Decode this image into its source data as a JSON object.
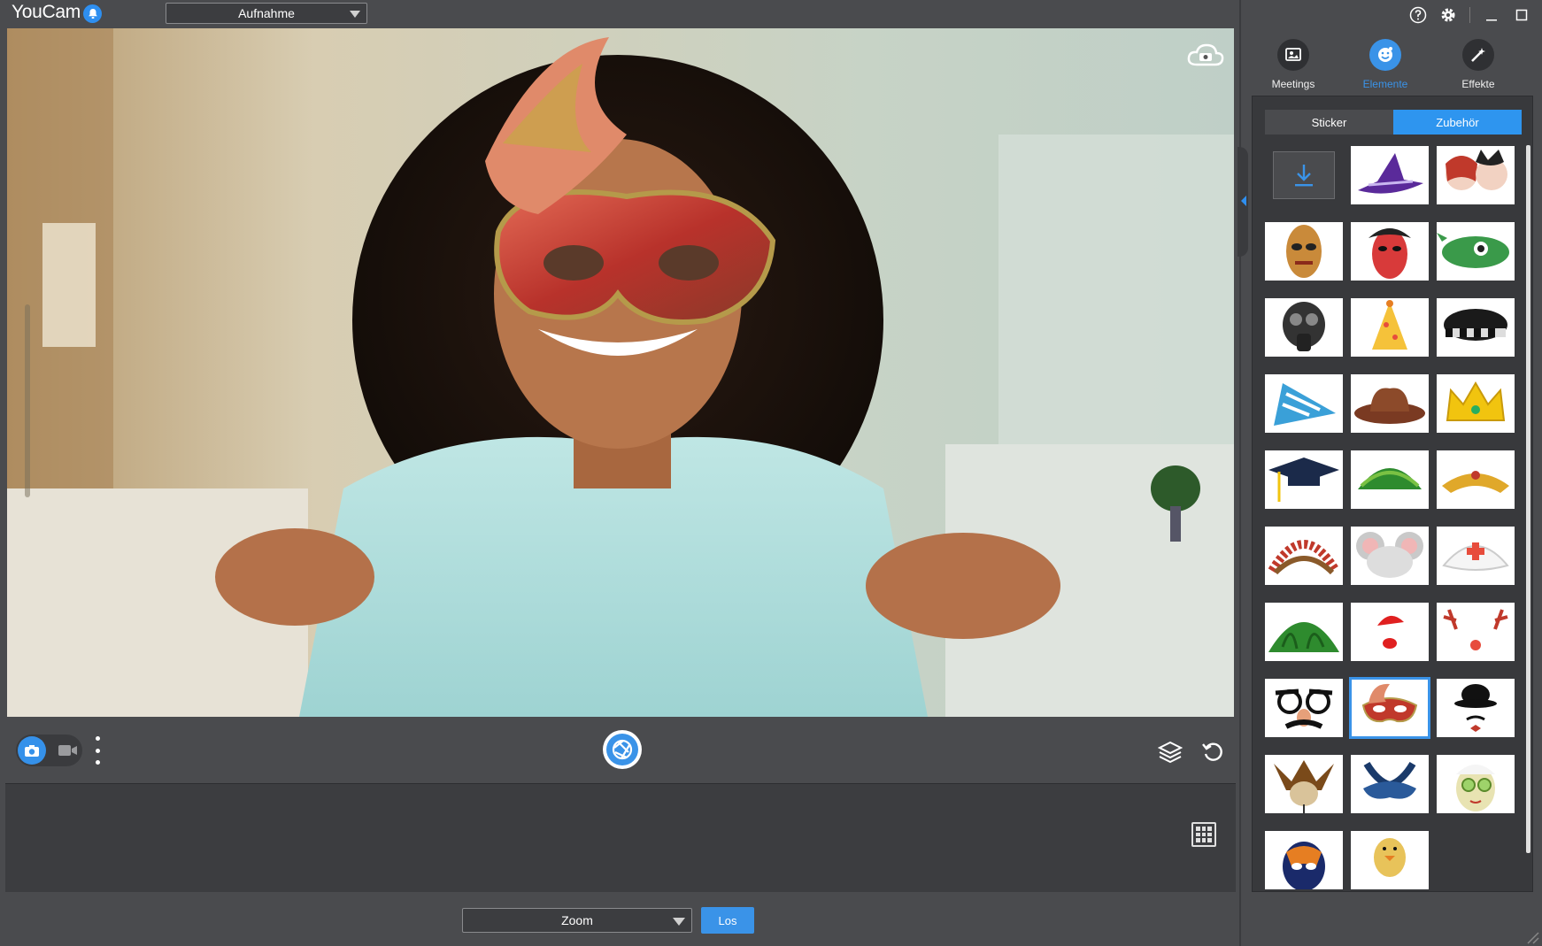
{
  "app": {
    "title": "YouCam"
  },
  "toolbar": {
    "mode_value": "Aufnahme"
  },
  "side_tabs": [
    {
      "label": "Meetings",
      "icon": "meetings-icon"
    },
    {
      "label": "Elemente",
      "icon": "elements-icon",
      "active": true
    },
    {
      "label": "Effekte",
      "icon": "effects-icon"
    }
  ],
  "sub_tabs": [
    {
      "label": "Sticker"
    },
    {
      "label": "Zubehör",
      "active": true
    }
  ],
  "accessories": [
    {
      "name": "download-more"
    },
    {
      "name": "witch-hat"
    },
    {
      "name": "angel-devil-masks"
    },
    {
      "name": "tribal-mask"
    },
    {
      "name": "opera-mask"
    },
    {
      "name": "fish-hat"
    },
    {
      "name": "gas-mask"
    },
    {
      "name": "party-hat"
    },
    {
      "name": "police-cap"
    },
    {
      "name": "striped-party-hat"
    },
    {
      "name": "cowboy-hat"
    },
    {
      "name": "gold-crown"
    },
    {
      "name": "graduation-cap"
    },
    {
      "name": "grass-headband"
    },
    {
      "name": "gold-tiara"
    },
    {
      "name": "feather-headdress"
    },
    {
      "name": "mouse-ears"
    },
    {
      "name": "nurse-cap"
    },
    {
      "name": "watermelon-hat"
    },
    {
      "name": "red-mini-hat"
    },
    {
      "name": "reindeer-antlers"
    },
    {
      "name": "groucho-glasses"
    },
    {
      "name": "venetian-mask",
      "selected": true
    },
    {
      "name": "bowler-hat-mustache"
    },
    {
      "name": "jester-mask"
    },
    {
      "name": "blue-feather-mask"
    },
    {
      "name": "cucumber-face-mask"
    },
    {
      "name": "luchador-mask"
    },
    {
      "name": "chick-hat"
    }
  ],
  "footer": {
    "app_select_value": "Zoom",
    "go_label": "Los"
  },
  "colors": {
    "accent": "#3a93e8",
    "background": "#4a4b4e",
    "panel": "#38393c"
  }
}
